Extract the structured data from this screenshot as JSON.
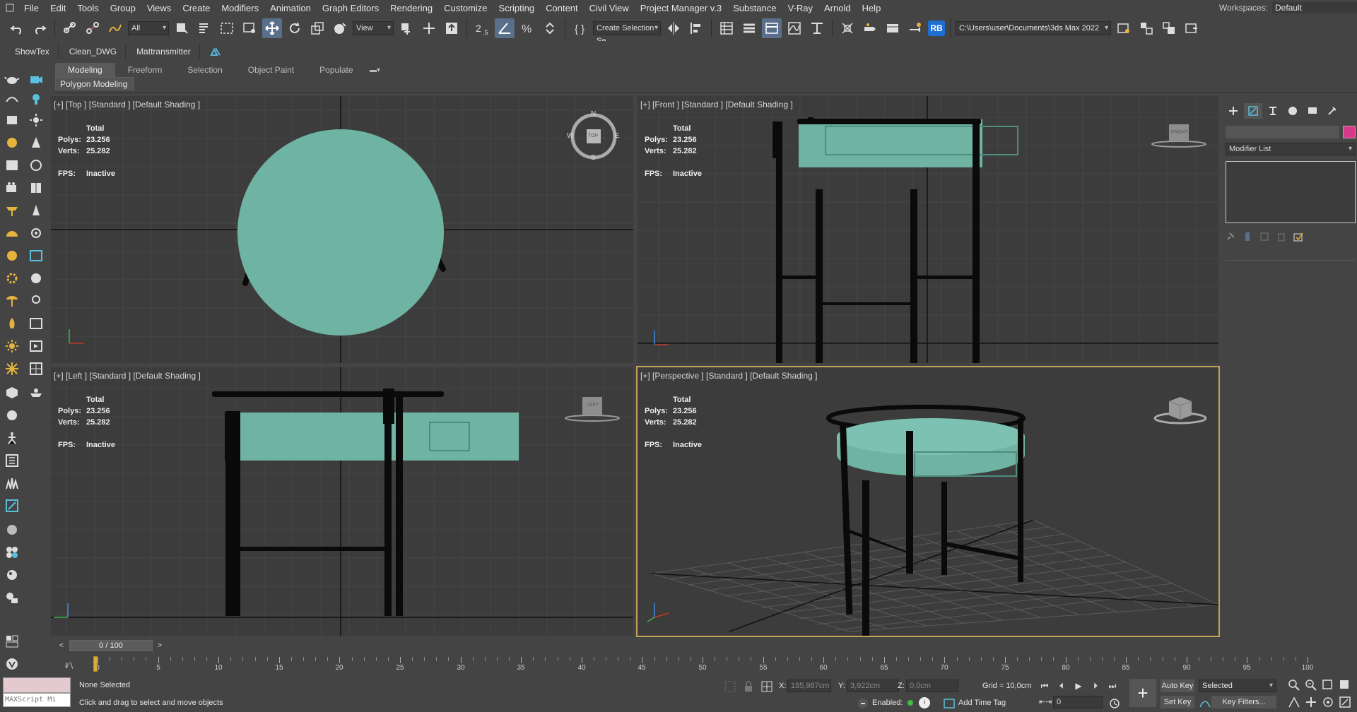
{
  "menu": [
    "File",
    "Edit",
    "Tools",
    "Group",
    "Views",
    "Create",
    "Modifiers",
    "Animation",
    "Graph Editors",
    "Rendering",
    "Customize",
    "Scripting",
    "Content",
    "Civil View",
    "Project Manager v.3",
    "Substance",
    "V-Ray",
    "Arnold",
    "Help"
  ],
  "workspaces": {
    "label": "Workspaces:",
    "value": "Default"
  },
  "toolbar": {
    "selection_filter": "All",
    "ref_coord": "View",
    "named_selection": "Create Selection Se",
    "rb_label": "RB",
    "path": "C:\\Users\\user\\Documents\\3ds Max 2022"
  },
  "shelf": [
    "ShowTex",
    "Clean_DWG",
    "Mattransmitter"
  ],
  "ribbon": {
    "tabs": [
      "Modeling",
      "Freeform",
      "Selection",
      "Object Paint",
      "Populate"
    ],
    "active_tab": "Modeling",
    "sub_panel": "Polygon Modeling"
  },
  "viewports": {
    "top": {
      "label": "[+] [Top ] [Standard ] [Default Shading ]"
    },
    "front": {
      "label": "[+] [Front ] [Standard ] [Default Shading ]"
    },
    "left": {
      "label": "[+] [Left ] [Standard ] [Default Shading ]"
    },
    "persp": {
      "label": "[+] [Perspective ] [Standard ] [Default Shading ]"
    },
    "stats": {
      "total": "Total",
      "polys_label": "Polys:",
      "polys": "23.256",
      "verts_label": "Verts:",
      "verts": "25.282",
      "fps_label": "FPS:",
      "fps": "Inactive"
    },
    "compass": {
      "n": "N",
      "s": "S",
      "w": "W",
      "e": "E",
      "cube_top": "TOP"
    },
    "cube_front": "FRONT",
    "cube_left": "LEFT"
  },
  "command_panel": {
    "modifier_list": "Modifier List"
  },
  "timeline": {
    "frame": "0 / 100",
    "prev": "<",
    "next": ">",
    "ticks": [
      0,
      5,
      10,
      15,
      20,
      25,
      30,
      35,
      40,
      45,
      50,
      55,
      60,
      65,
      70,
      75,
      80,
      85,
      90,
      95,
      100
    ]
  },
  "status": {
    "maxscript_placeholder": "MAXScript Mi",
    "selection": "None Selected",
    "prompt": "Click and drag to select and move objects",
    "x_label": "X:",
    "x": "185,987cm",
    "y_label": "Y:",
    "y": "3,922cm",
    "z_label": "Z:",
    "z": "0,0cm",
    "grid": "Grid = 10,0cm",
    "enabled": "Enabled:",
    "add_time_tag": "Add Time Tag",
    "auto_key": "Auto Key",
    "set_key": "Set Key",
    "selected": "Selected",
    "key_filters": "Key Filters...",
    "current_frame": "0"
  },
  "colors": {
    "accent_selected_viewport": "#c3a35b",
    "model_teal": "#6fb3a3",
    "model_metal": "#111111",
    "object_color": "#d73a8a",
    "rb_blue": "#1d6fd1"
  }
}
